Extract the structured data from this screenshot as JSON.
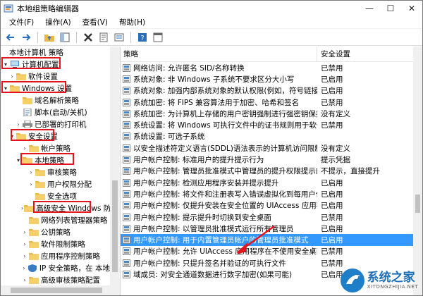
{
  "window": {
    "title": "本地组策略编辑器"
  },
  "menu": [
    "文件(F)",
    "操作(A)",
    "查看(V)",
    "帮助(H)"
  ],
  "tree": [
    {
      "label": "本地计算机 策略",
      "level": 0,
      "exp": "",
      "icon": "none"
    },
    {
      "label": "计算机配置",
      "level": 0,
      "exp": "▾",
      "icon": "computer"
    },
    {
      "label": "软件设置",
      "level": 1,
      "exp": "›",
      "icon": "folder"
    },
    {
      "label": "Windows 设置",
      "level": 0,
      "exp": "▾",
      "icon": "folder"
    },
    {
      "label": "域名解析策略",
      "level": 2,
      "exp": "",
      "icon": "folder"
    },
    {
      "label": "脚本(启动/关机)",
      "level": 2,
      "exp": "",
      "icon": "doc"
    },
    {
      "label": "已部署的打印机",
      "level": 2,
      "exp": "›",
      "icon": "printer"
    },
    {
      "label": "安全设置",
      "level": 1,
      "exp": "▾",
      "icon": "folder"
    },
    {
      "label": "帐户策略",
      "level": 3,
      "exp": "›",
      "icon": "folder"
    },
    {
      "label": "本地策略",
      "level": 2,
      "exp": "▾",
      "icon": "folder"
    },
    {
      "label": "审核策略",
      "level": 4,
      "exp": "›",
      "icon": "folder"
    },
    {
      "label": "用户权限分配",
      "level": 4,
      "exp": "›",
      "icon": "folder"
    },
    {
      "label": "安全选项",
      "level": 4,
      "exp": "",
      "icon": "folder"
    },
    {
      "label": "高级安全 Windows 防",
      "level": 3,
      "exp": "›",
      "icon": "folder"
    },
    {
      "label": "网络列表管理器策略",
      "level": 3,
      "exp": "",
      "icon": "folder"
    },
    {
      "label": "公钥策略",
      "level": 3,
      "exp": "›",
      "icon": "folder"
    },
    {
      "label": "软件限制策略",
      "level": 3,
      "exp": "›",
      "icon": "folder"
    },
    {
      "label": "应用程序控制策略",
      "level": 3,
      "exp": "›",
      "icon": "folder"
    },
    {
      "label": "IP 安全策略，在 本地",
      "level": 3,
      "exp": "›",
      "icon": "shield"
    },
    {
      "label": "高级审核策略配置",
      "level": 3,
      "exp": "›",
      "icon": "folder"
    }
  ],
  "columns": {
    "policy": "策略",
    "setting": "安全设置"
  },
  "rows": [
    {
      "policy": "网络访问: 允许匿名 SID/名称转换",
      "setting": "已禁用"
    },
    {
      "policy": "系统对象: 非 Windows 子系统不要求区分大小写",
      "setting": "已启用"
    },
    {
      "policy": "系统对象: 加强内部系统对象的默认权限(例如，符号链接)",
      "setting": "已启用"
    },
    {
      "policy": "系统加密: 将 FIPS 兼容算法用于加密、哈希和签名",
      "setting": "已禁用"
    },
    {
      "policy": "系统加密: 为计算机上存储的用户密钥强制进行强密钥保护",
      "setting": "没有定义"
    },
    {
      "policy": "系统设置: 将 Windows 可执行文件中的证书规则用于软件...",
      "setting": "已禁用"
    },
    {
      "policy": "系统设置: 可选子系统",
      "setting": ""
    },
    {
      "policy": "以安全描述符定义语言(SDDL)语法表示的计算机访问限制",
      "setting": "没有定义"
    },
    {
      "policy": "用户帐户控制: 标准用户的提升提示行为",
      "setting": "提示凭据"
    },
    {
      "policy": "用户帐户控制: 管理员批准模式中管理员的提升权限提示的...",
      "setting": "不提示，直接提升"
    },
    {
      "policy": "用户帐户控制: 检测应用程序安装并提示提升",
      "setting": "已启用"
    },
    {
      "policy": "用户帐户控制: 将文件和注册表写入错误虚拟化到每用户位置",
      "setting": "已启用"
    },
    {
      "policy": "用户帐户控制: 仅提升安装在安全位置的 UIAccess 应用程序",
      "setting": "已启用"
    },
    {
      "policy": "用户帐户控制: 提示提升时切换到安全桌面",
      "setting": "已禁用"
    },
    {
      "policy": "用户帐户控制: 以管理员批准模式运行所有管理员",
      "setting": "已启用"
    },
    {
      "policy": "用户帐户控制: 用于内置管理员帐户的管理员批准模式",
      "setting": "已启用",
      "selected": true
    },
    {
      "policy": "用户帐户控制: 允许 UIAccess 应用程序在不使用安全桌面...",
      "setting": "已禁用"
    },
    {
      "policy": "用户帐户控制: 只提升签名并验证的可执行文件",
      "setting": "已禁用"
    },
    {
      "policy": "域成员: 对安全通道数据进行数字加密(如果可能)",
      "setting": "已启用"
    }
  ],
  "watermark": {
    "title": "系统之家",
    "url": "XITONGZHIJIA.NET"
  },
  "colors": {
    "annotation": "#e3141f",
    "selection": "#3399ff",
    "arrow": "#e3141f"
  }
}
